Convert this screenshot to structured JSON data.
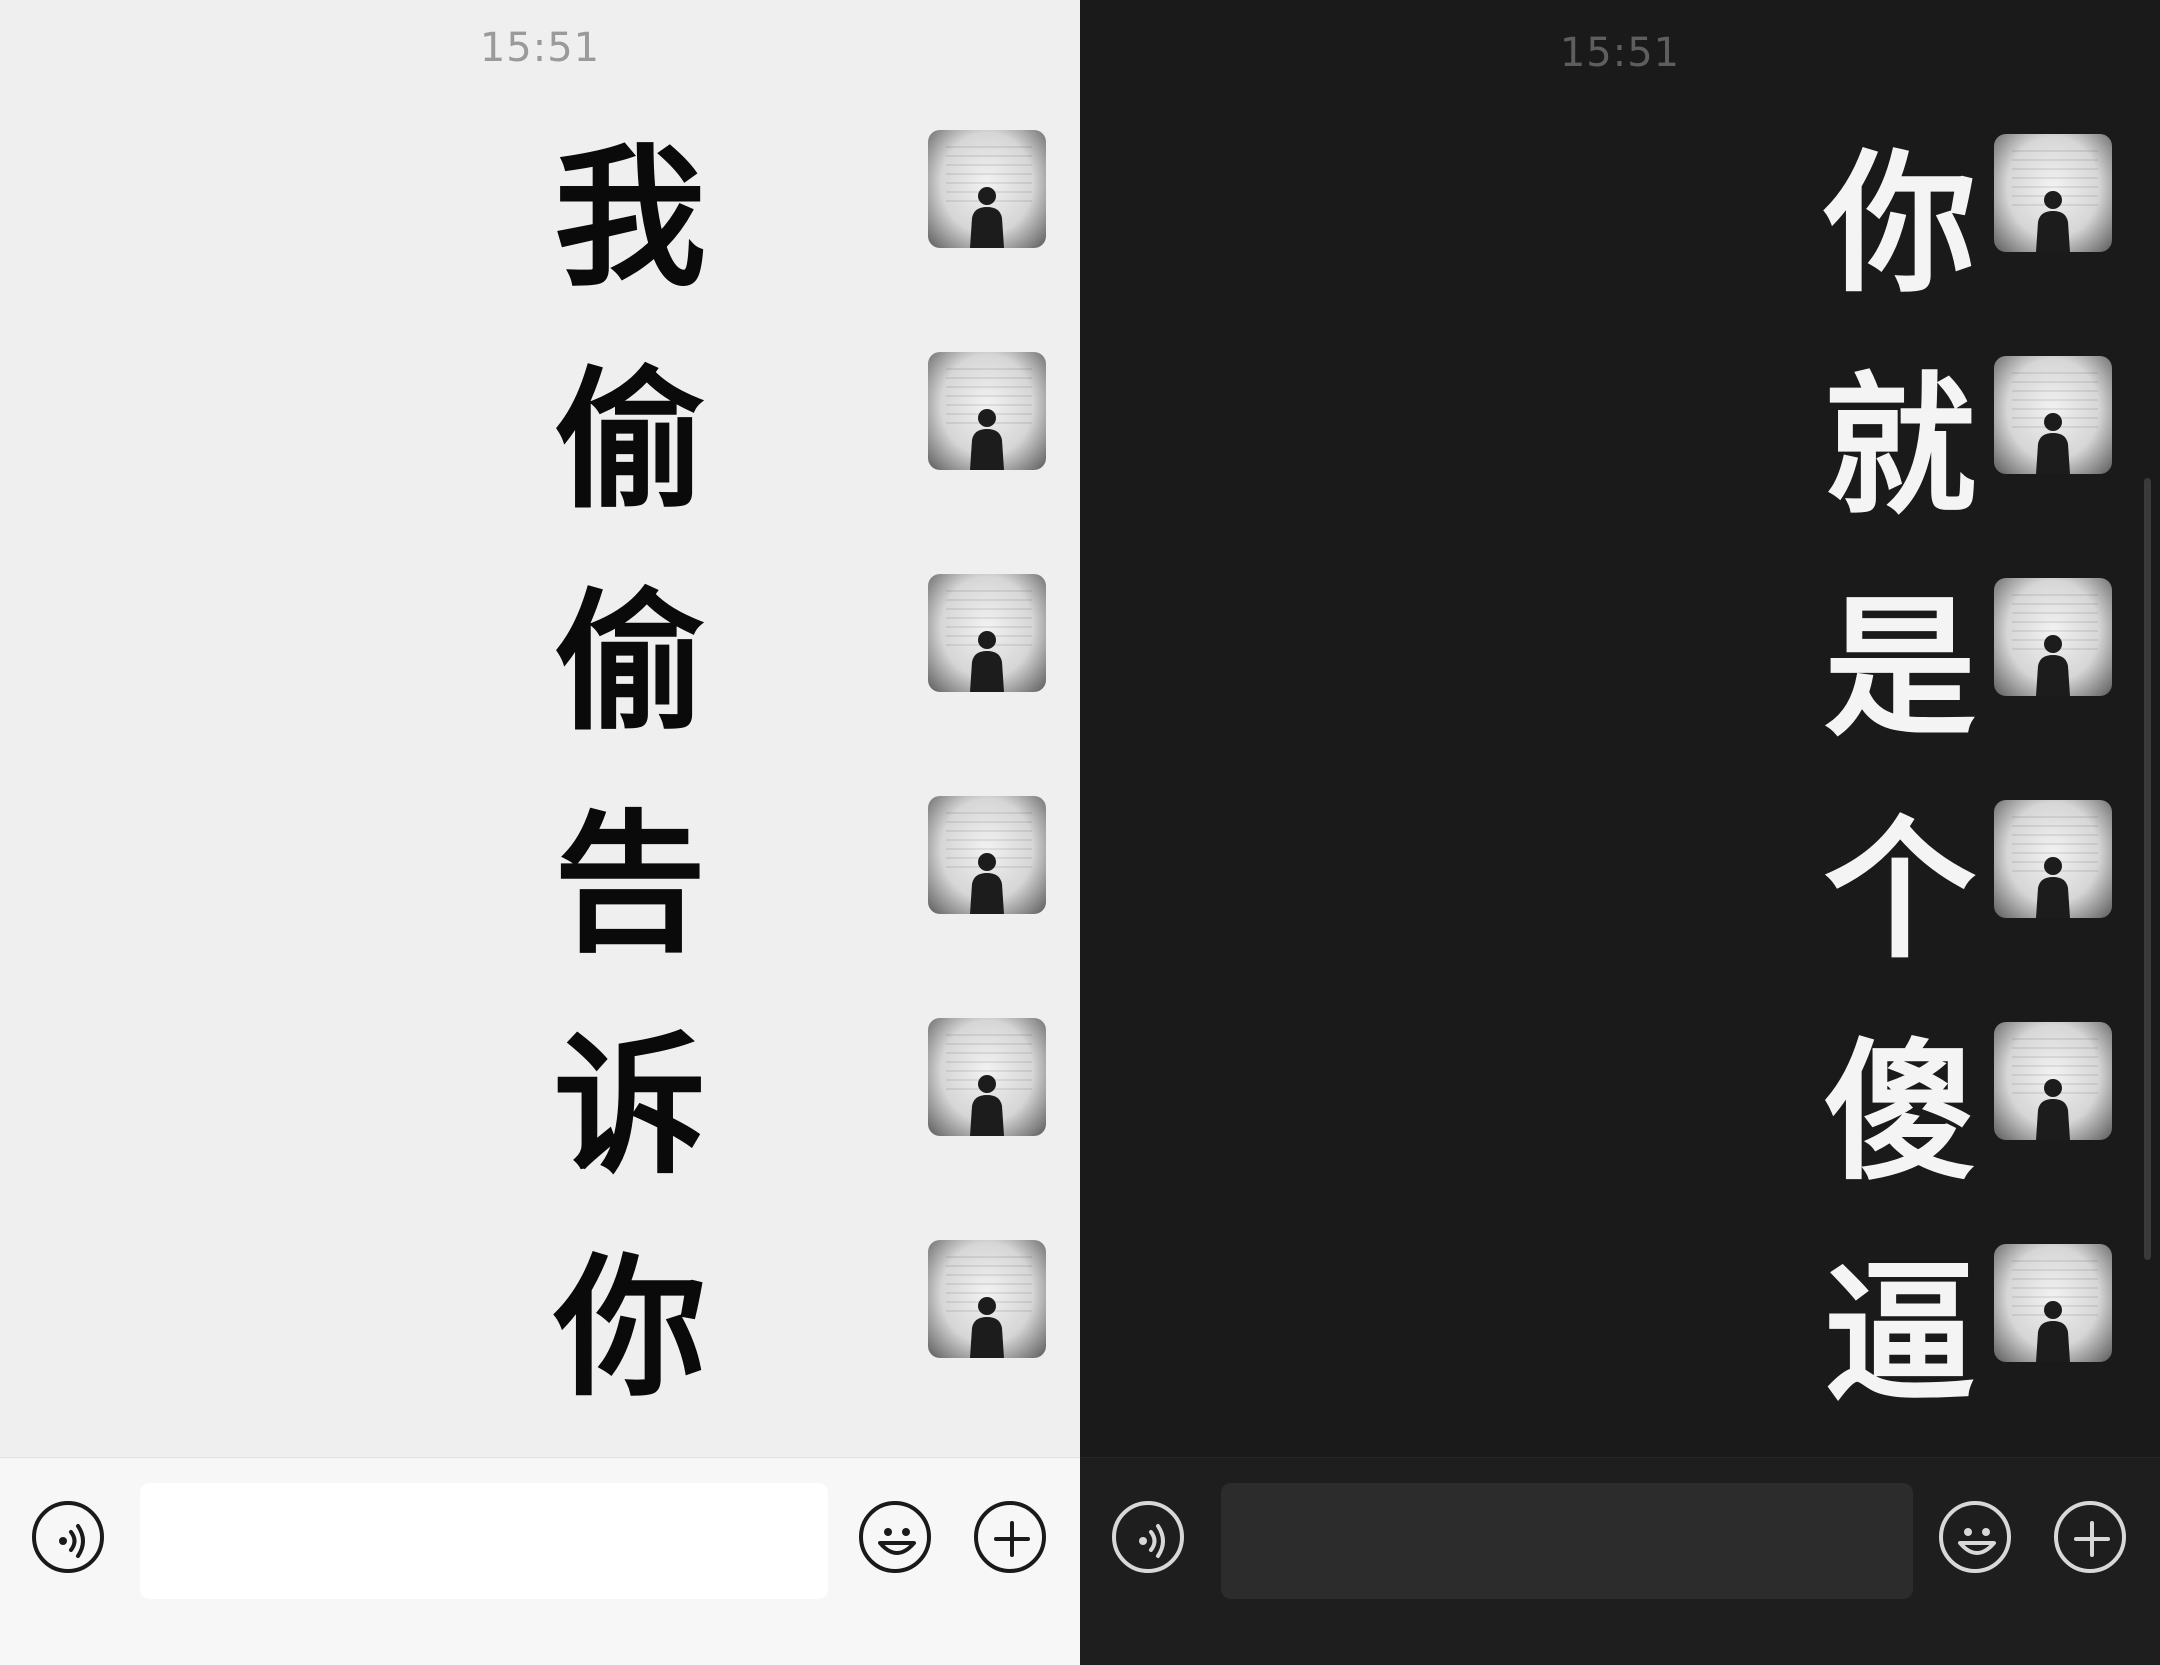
{
  "left_panel": {
    "time": "15:51",
    "messages": [
      "我",
      "偷",
      "偷",
      "告",
      "诉",
      "你"
    ]
  },
  "right_panel": {
    "time": "15:51",
    "messages": [
      "你",
      "就",
      "是",
      "个",
      "傻",
      "逼"
    ]
  },
  "input_bar": {
    "voice_icon": "voice-icon",
    "emoji_icon": "emoji-icon",
    "plus_icon": "plus-icon"
  },
  "colors": {
    "light_bg": "#efefef",
    "dark_bg": "#1a1a1a"
  }
}
